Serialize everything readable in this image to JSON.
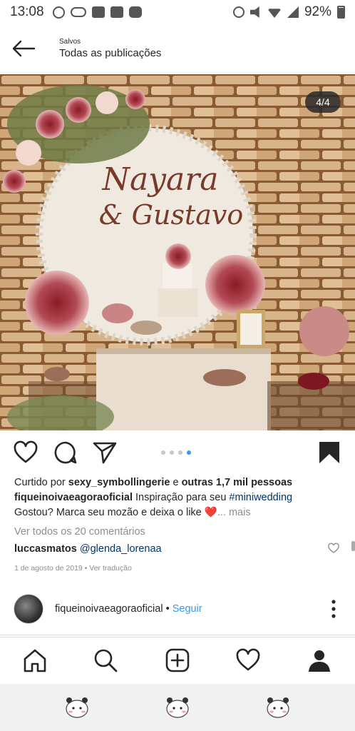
{
  "status_bar": {
    "time": "13:08",
    "battery": "92%"
  },
  "header": {
    "subtitle": "Salvos",
    "title": "Todas as publicações"
  },
  "post": {
    "image_counter": "4/4",
    "image_text_line1": "Nayara",
    "image_text_line2": "& Gustavo",
    "carousel": {
      "total": 4,
      "active_index": 3
    },
    "likes": {
      "prefix": "Curtido por ",
      "user": "sexy_symbollingerie",
      "middle": " e ",
      "others": "outras 1,7 mil pessoas"
    },
    "caption": {
      "username": "fiqueinoivaeagoraoficial",
      "text_before": " Inspiração para seu ",
      "hashtag": "#miniwedding",
      "line2": "Gostou? Marca seu mozão e deixa o like ",
      "heart": "❤️",
      "more": "... mais"
    },
    "view_comments": "Ver todos os 20 comentários",
    "comment": {
      "username": "luccasmatos",
      "mention": "@glenda_lorenaa"
    },
    "date": "1 de agosto de 2019",
    "separator": " • ",
    "translate": "Ver tradução"
  },
  "next_post": {
    "username": "fiqueinoivaeagoraoficial",
    "separator": " • ",
    "follow": "Seguir"
  },
  "colors": {
    "link_blue": "#3897f0",
    "hashtag": "#003569",
    "muted": "#8e8e8e",
    "text": "#262626"
  },
  "icons": {
    "back": "arrow-left-icon",
    "like": "heart-icon",
    "comment": "comment-icon",
    "share": "send-icon",
    "save": "bookmark-icon",
    "home": "home-icon",
    "search": "search-icon",
    "add": "add-post-icon",
    "activity": "heart-icon",
    "profile": "profile-icon"
  }
}
